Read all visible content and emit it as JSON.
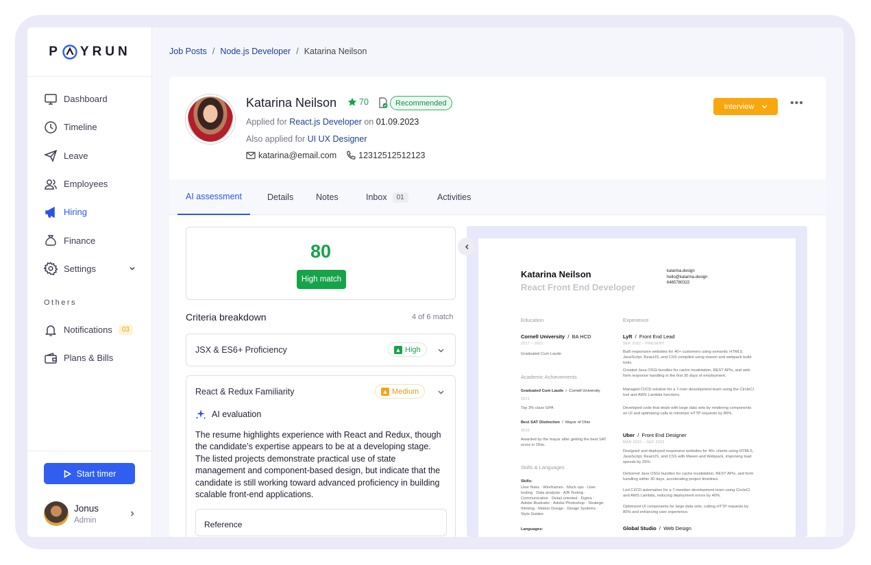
{
  "brand": {
    "logo_text_left": "P",
    "logo_text_right": "YRUN"
  },
  "sidebar": {
    "items": [
      {
        "label": "Dashboard"
      },
      {
        "label": "Timeline"
      },
      {
        "label": "Leave"
      },
      {
        "label": "Employees"
      },
      {
        "label": "Hiring"
      },
      {
        "label": "Finance"
      },
      {
        "label": "Settings"
      }
    ],
    "others_label": "Others",
    "others": [
      {
        "label": "Notifications",
        "badge": "03"
      },
      {
        "label": "Plans & Bills"
      }
    ],
    "start_timer": "Start timer",
    "user": {
      "name": "Jonus",
      "role": "Admin"
    }
  },
  "breadcrumb": {
    "items": [
      "Job Posts",
      "Node.js Developer",
      "Katarina Neilson"
    ],
    "sep": "/"
  },
  "candidate": {
    "name": "Katarina Neilson",
    "score": "70",
    "recommended": "Recommended",
    "applied_prefix": "Applied for",
    "applied_role": "React.js Developer",
    "applied_on": "on",
    "applied_date": "01.09.2023",
    "also_prefix": "Also applied for",
    "also_role": "UI UX Designer",
    "email": "katarina@email.com",
    "phone": "12312512512123",
    "status_button": "Interview"
  },
  "tabs": [
    {
      "label": "AI assessment"
    },
    {
      "label": "Details"
    },
    {
      "label": "Notes"
    },
    {
      "label": "Inbox",
      "count": "01"
    },
    {
      "label": "Activities"
    }
  ],
  "assessment": {
    "score": "80",
    "match": "High match",
    "criteria_title": "Criteria breakdown",
    "criteria_count": "4 of 6 match",
    "criteria": [
      {
        "label": "JSX & ES6+ Proficiency",
        "level": "High"
      },
      {
        "label": "React & Redux Familiarity",
        "level": "Medium"
      }
    ],
    "ai_title": "AI evaluation",
    "ai_text": "The resume highlights experience with React and Redux, though the candidate’s expertise appears to be at a developing stage. The listed projects demonstrate practical use of state management and component-based design, but indicate that the candidate is still working toward advanced proficiency in building scalable front-end applications.",
    "reference_label": "Reference"
  },
  "resume": {
    "name": "Katarina Neilson",
    "role": "React Front End Developer",
    "contact": [
      "katarina.design",
      "hello@katarina.design",
      "6465780322"
    ],
    "education_title": "Education",
    "school": "Cornell University",
    "degree": "BA HCD",
    "school_dates": "2017 – 2021",
    "school_note": "Graduated Cum Laude",
    "achievements_title": "Academic Achievements",
    "ach1_title": "Graduated Cum Laude",
    "ach1_org": "Cornell University",
    "ach1_year": "2021",
    "ach1_note": "Top 3% class GPA",
    "ach2_title": "Best SAT Distinction",
    "ach2_org": "Mayor of Ohio",
    "ach2_year": "2016",
    "ach2_note": "Awarded by the mayor after getting the best SAT score in Ohio.",
    "skills_title": "Skills & Languages",
    "skills_label": "Skills:",
    "skills_text": "User flows · Wireframes · Mock ups · User testing · Data analysis · A/B Testing · Communicative · Detail oriented · Figma · Adobe Illustrator · Adobe Photoshop · Strategic thinking · Motion Design · Design Systems · Style Guides",
    "languages_label": "Languages:",
    "experience_title": "Experience",
    "job1_company": "Lyft",
    "job1_role": "Front End Lead",
    "job1_dates": "SEP 2022 – PRESENT",
    "job1_b1": "Built responsive websites for 40+ customers using semantic HTML5, JavaScript, ReactJS, and CSS compiled using maven and webpack build tools.",
    "job1_b2": "Created Java OSGi bundles for cache invalidation, REST APIs, and web form response handling in the first 30 days of employment.",
    "job1_b3": "Managed CI/CD solution for a 7-men development team using the CircleCI tool and AWS Lambda functions.",
    "job1_b4": "Developed code that deals with large data sets by rendering components on UI and optimizing calls to minimize HTTP requests by 80%.",
    "job2_company": "Uber",
    "job2_role": "Front End Designer",
    "job2_dates": "MAR 2022 – SEP 2022",
    "job2_b1": "Designed and deployed responsive websites for 40+ clients using HTML5, JavaScript, ReactJS, and CSS with Maven and Webpack, improving load speeds by 25%.",
    "job2_b2": "Delivered Java OSGi bundles for cache invalidation, REST APIs, and form handling within 30 days, accelerating project timelines.",
    "job2_b3": "Led CI/CD automation for a 7-member development team using CircleCI and AWS Lambda, reducing deployment errors by 40%.",
    "job2_b4": "Optimized UI components for large data sets, cutting HTTP requests by 80% and enhancing user experience.",
    "job3_company": "Global Studio",
    "job3_role": "Web Design",
    "slash": "/"
  },
  "colors": {
    "accent": "#2954e5",
    "success": "#16a34a",
    "warning": "#f9a70e"
  }
}
